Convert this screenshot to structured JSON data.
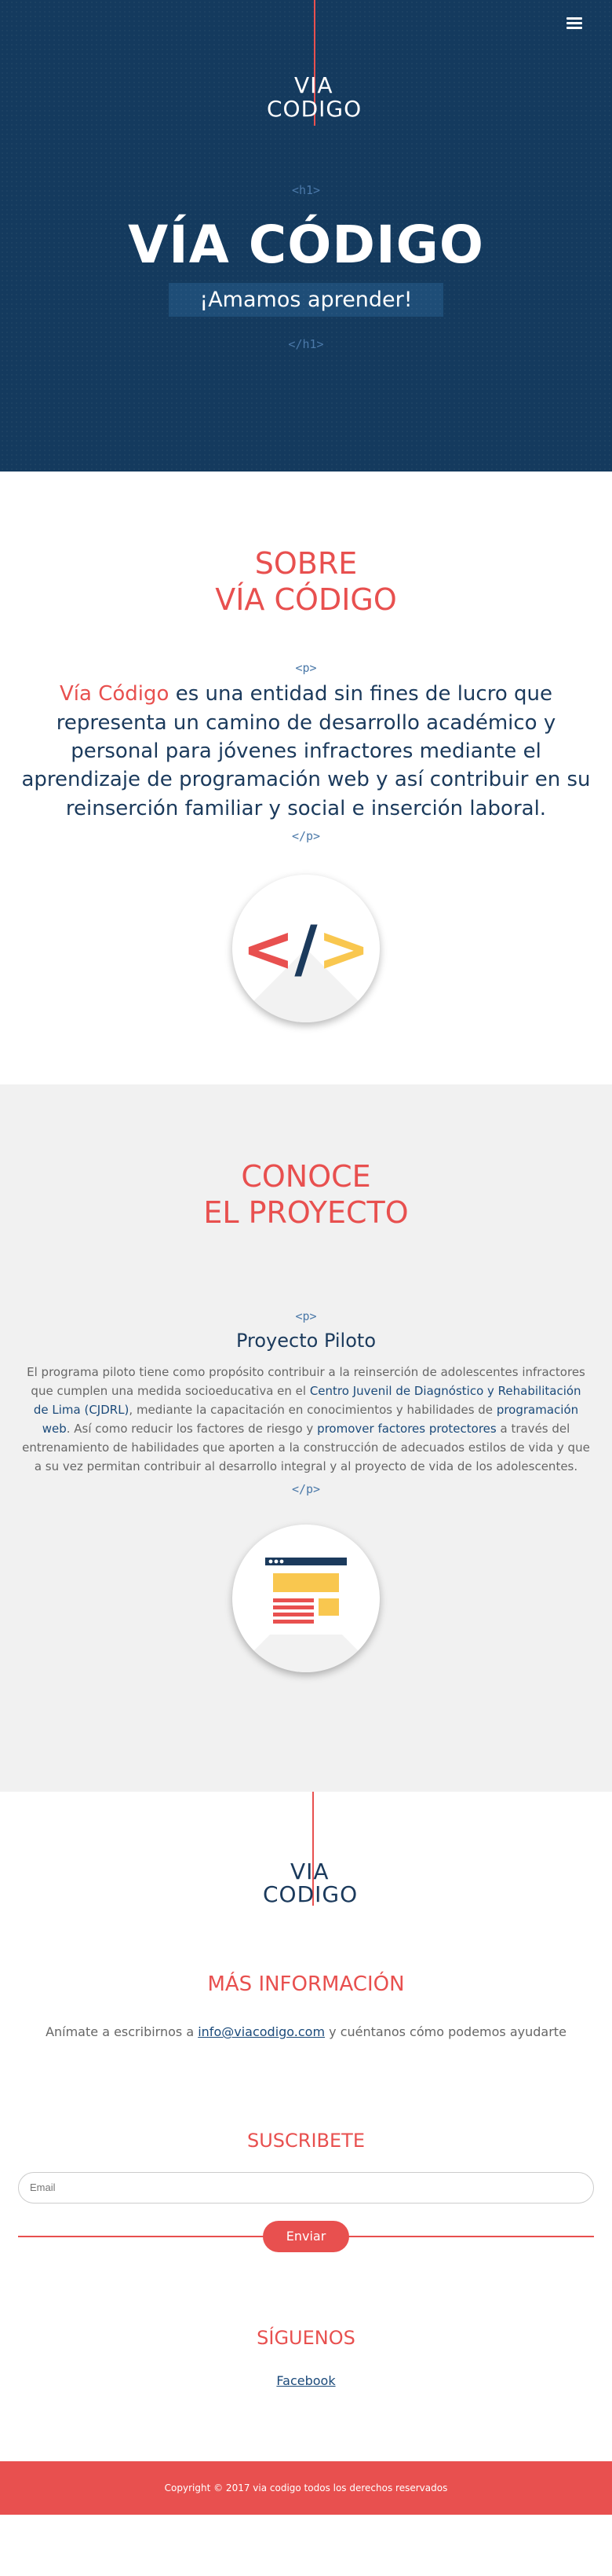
{
  "hero": {
    "logo_line1": "VIA",
    "logo_line2": "CODIGO",
    "tag_open": "<h1>",
    "title": "VÍA CÓDIGO",
    "subtitle": "¡Amamos  aprender!",
    "tag_close": "</h1>"
  },
  "about": {
    "title_line1": "SOBRE",
    "title_line2": "VÍA CÓDIGO",
    "tag_open": "<p>",
    "lead_accent": "Vía Código",
    "lead_rest": " es una entidad sin fines de lucro que representa un camino de desarrollo académico y personal para jóvenes infractores mediante el aprendizaje de programación web y así contribuir en su reinserción familiar y social e inserción laboral.",
    "tag_close": "</p>",
    "icon_open": "<",
    "icon_slash": "/",
    "icon_close": ">"
  },
  "project": {
    "title_line1": "CONOCE",
    "title_line2": "EL PROYECTO",
    "tag_open": "<p>",
    "heading": "Proyecto Piloto",
    "body_1": "El programa piloto tiene como propósito contribuir a la reinserción de adolescentes infractores que cumplen una medida socioeducativa en el ",
    "link_1": "Centro Juvenil de Diagnóstico y Rehabilitación de Lima (CJDRL)",
    "body_2": ", mediante la capacitación en conocimientos y habilidades de ",
    "link_2": "programación web",
    "body_3": ". Así como reducir los factores de riesgo y ",
    "link_3": "promover factores protectores",
    "body_4": " a través del entrenamiento de habilidades que aporten a la construcción de adecuados estilos de vida y que a su vez permitan contribuir al desarrollo integral y al proyecto de vida de los adolescentes.",
    "tag_close": "</p>"
  },
  "footer_logo": {
    "line1": "VIA",
    "line2": "CODIGO"
  },
  "info": {
    "title": "MÁS INFORMACIÓN",
    "text_before": "Anímate a escribirnos a ",
    "email": "info@viacodigo.com",
    "text_after": " y cuéntanos cómo podemos ayudarte"
  },
  "subscribe": {
    "title": "SUSCRIBETE",
    "email_placeholder": "Email",
    "button": "Enviar"
  },
  "follow": {
    "title": "SÍGUENOS",
    "facebook": "Facebook"
  },
  "footer": {
    "copyright": "Copyright © 2017 via codigo todos los derechos reservados"
  },
  "colors": {
    "hero_bg": "#143a5e",
    "accent": "#e8504f",
    "navy": "#1b3a5c",
    "yellow": "#f9c74f"
  }
}
